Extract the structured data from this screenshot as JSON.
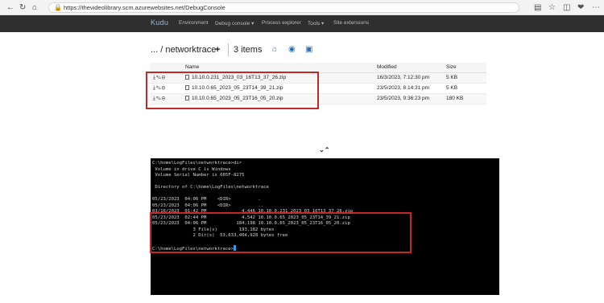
{
  "browser": {
    "url": "https://thevideolibrary.scm.azurewebsites.net/DebugConsole"
  },
  "kudu_nav": {
    "brand": "Kudu",
    "items": [
      "Environment",
      "Debug console ▾",
      "Process explorer",
      "Tools ▾",
      "Site extensions"
    ]
  },
  "explorer": {
    "breadcrumb": "... / networktrace",
    "item_count": "3 items",
    "columns": {
      "name": "Name",
      "modified": "Modified",
      "size": "Size"
    },
    "files": [
      {
        "name": "10.10.0.231_2023_03_16T13_37_26.zip",
        "modified": "16/3/2023, 7:12:30 pm",
        "size": "5 KB"
      },
      {
        "name": "10.10.0.65_2023_05_23T14_39_21.zip",
        "modified": "23/5/2023, 8:14:31 pm",
        "size": "5 KB"
      },
      {
        "name": "10.10.0.65_2023_05_23T16_05_20.zip",
        "modified": "23/5/2023, 9:36:23 pm",
        "size": "180 KB"
      }
    ]
  },
  "console": {
    "lines": [
      "C:\\home\\LogFiles\\networktrace>dir",
      " Volume in drive C is Windows",
      " Volume Serial Number is 605F-8275",
      "",
      " Directory of C:\\home\\LogFiles\\networktrace",
      "",
      "05/23/2023  04:06 PM    <DIR>          .",
      "05/23/2023  04:06 PM    <DIR>          ..",
      "03/16/2023  01:42 PM             4,446 10.10.0.231_2023_03_16T13_37_26.zip",
      "05/23/2023  02:44 PM             4,542 10.10.0.65_2023_05_23T14_39_21.zip",
      "05/23/2023  04:06 PM           184,198 10.10.0.65_2023_05_23T16_05_20.zip",
      "               3 File(s)        193,182 bytes",
      "               2 Dir(s)  53,633,404,928 bytes free",
      "",
      "C:\\home\\LogFiles\\networktrace>"
    ]
  }
}
